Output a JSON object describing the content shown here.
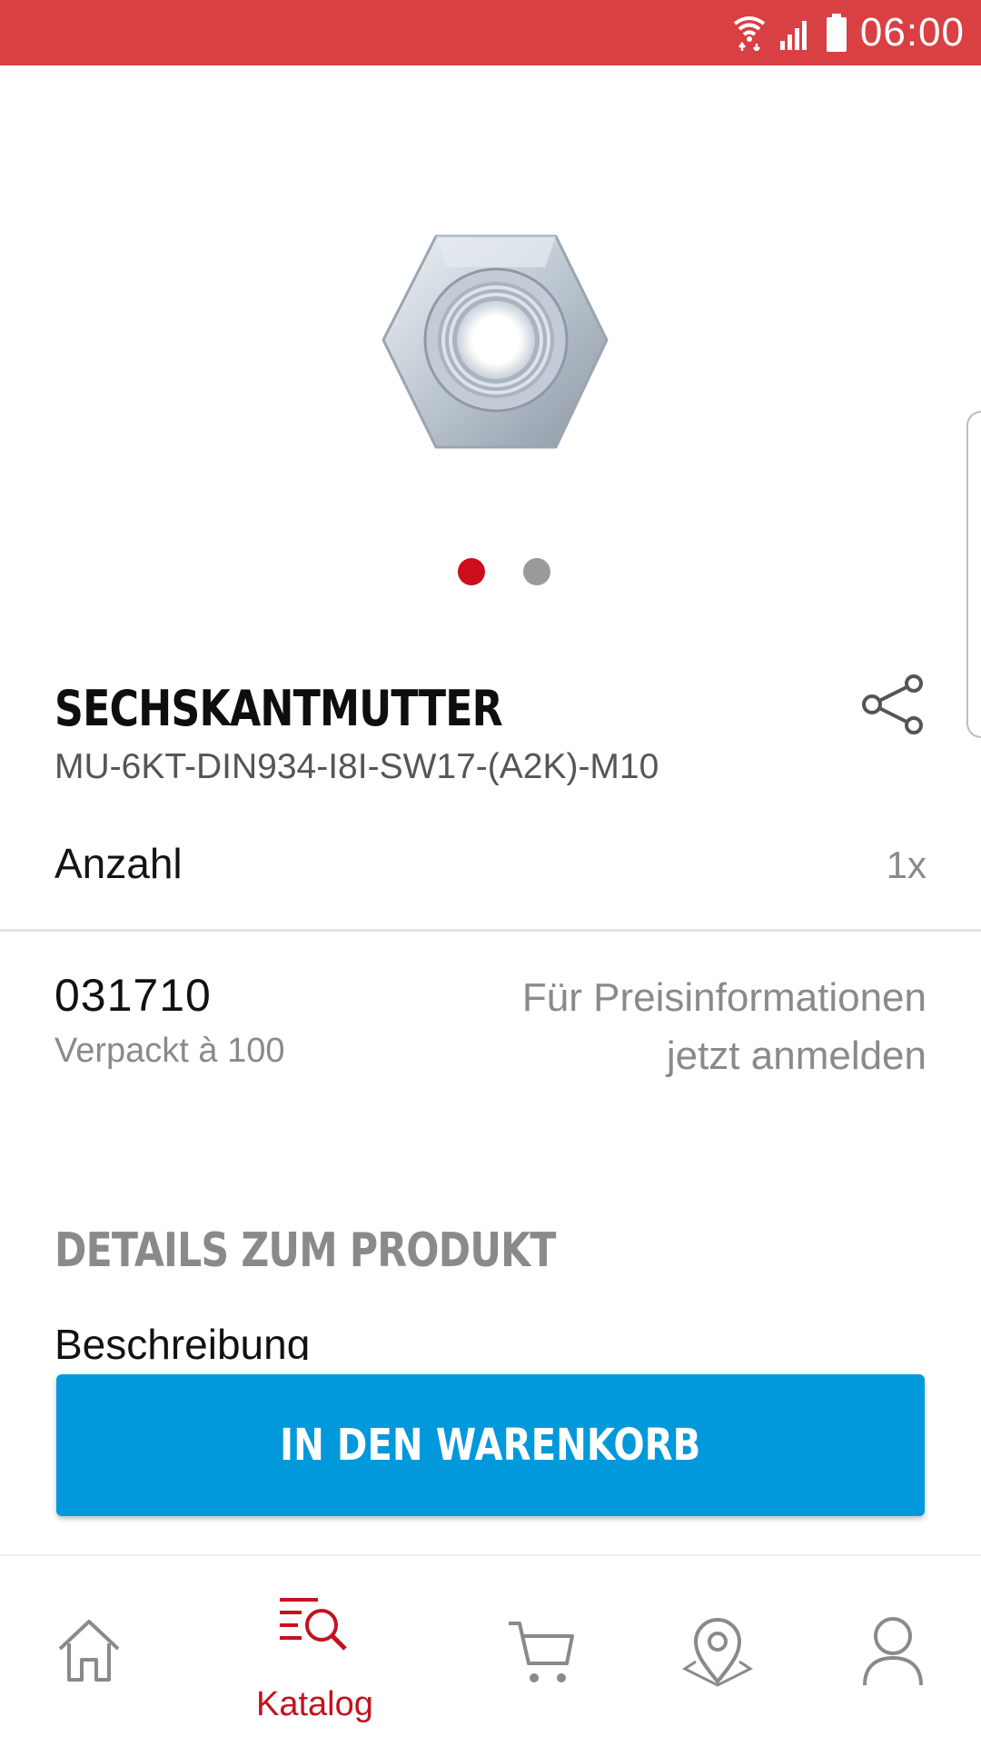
{
  "status_bar": {
    "time": "06:00",
    "icons": [
      "wifi-icon",
      "signal-icon",
      "battery-icon"
    ]
  },
  "gallery": {
    "slide_count": 2,
    "active_index": 0
  },
  "product": {
    "title": "SECHSKANTMUTTER",
    "sku_code": "MU-6KT-DIN934-I8I-SW17-(A2K)-M10"
  },
  "quantity": {
    "label": "Anzahl",
    "value": "1x"
  },
  "article": {
    "number": "031710",
    "pack_info": "Verpackt à 100",
    "price_line1": "Für Preisinformationen",
    "price_line2": "jetzt anmelden"
  },
  "details": {
    "heading": "DETAILS ZUM PRODUKT",
    "description_label": "Beschreibung"
  },
  "cart_button": {
    "label": "IN DEN WARENKORB"
  },
  "bottom_nav": {
    "items": [
      {
        "icon": "home-icon",
        "label": ""
      },
      {
        "icon": "catalog-search-icon",
        "label": "Katalog",
        "active": true
      },
      {
        "icon": "cart-icon",
        "label": ""
      },
      {
        "icon": "location-icon",
        "label": ""
      },
      {
        "icon": "profile-icon",
        "label": ""
      }
    ]
  },
  "colors": {
    "status_bar": "#d94043",
    "accent_red": "#c4121f",
    "button_blue": "#0299dc",
    "muted_text": "#8a8a8a"
  }
}
